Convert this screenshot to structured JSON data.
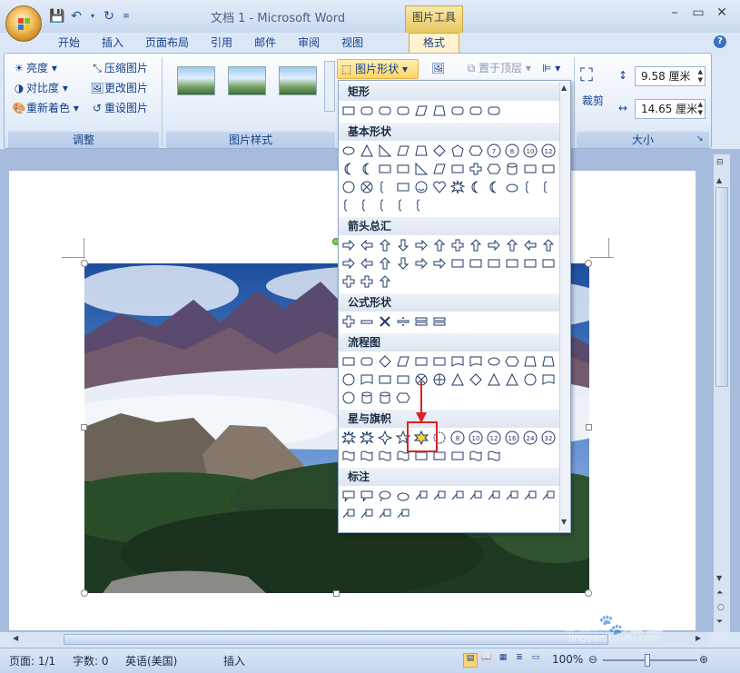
{
  "window": {
    "title": "文档 1 - Microsoft Word",
    "context_tab": "图片工具"
  },
  "tabs": [
    "开始",
    "插入",
    "页面布局",
    "引用",
    "邮件",
    "审阅",
    "视图"
  ],
  "active_tab": "格式",
  "ribbon": {
    "adjust": {
      "label": "调整",
      "brightness": "亮度",
      "contrast": "对比度",
      "recolor": "重新着色",
      "compress": "压缩图片",
      "change": "更改图片",
      "reset": "重设图片"
    },
    "picture_styles": {
      "label": "图片样式"
    },
    "picture_shape": "图片形状",
    "bring_front": "置于顶层",
    "crop": "裁剪",
    "size": {
      "label": "大小",
      "height": "9.58 厘米",
      "width": "14.65 厘米"
    }
  },
  "gallery": {
    "sections": [
      {
        "title": "矩形"
      },
      {
        "title": "基本形状"
      },
      {
        "title": "箭头总汇"
      },
      {
        "title": "公式形状"
      },
      {
        "title": "流程图"
      },
      {
        "title": "星与旗帜"
      },
      {
        "title": "标注"
      }
    ],
    "star_numbers": [
      "8",
      "10",
      "12",
      "16",
      "24",
      "32"
    ],
    "basic_numbers": [
      "7",
      "8",
      "10",
      "12"
    ]
  },
  "status": {
    "page": "页面: 1/1",
    "words": "字数: 0",
    "language": "英语(美国)",
    "mode": "插入",
    "zoom": "100%"
  },
  "watermark": {
    "brand": "Bai",
    "brand2": "经验",
    "url": "jingyan.baidu.com"
  },
  "colors": {
    "highlight": "#e02020",
    "ribbon_accent": "#ffd567"
  }
}
